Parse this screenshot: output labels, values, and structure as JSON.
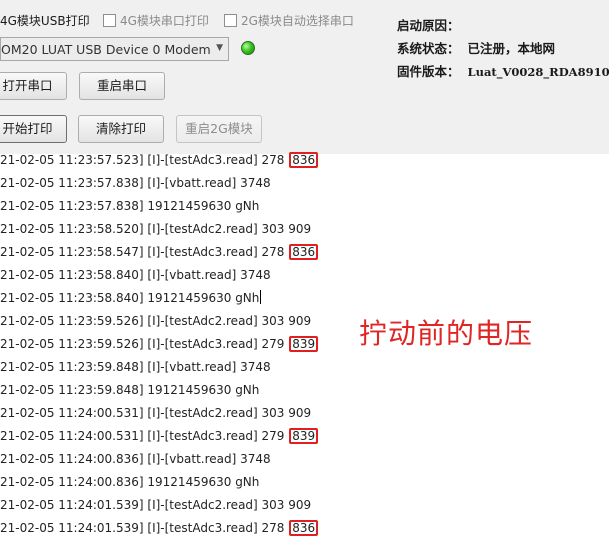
{
  "options": [
    {
      "label": "4G模块USB打印",
      "checkbox": false,
      "enabled": true
    },
    {
      "label": "4G模块串口打印",
      "checkbox": true,
      "checked": false,
      "enabled": false
    },
    {
      "label": "2G模块自动选择串口",
      "checkbox": true,
      "checked": false,
      "enabled": false
    }
  ],
  "port_select": {
    "value": "OM20 LUAT USB Device 0 Modem (C"
  },
  "status_led": {
    "color": "#39c621"
  },
  "buttons": {
    "open_port": "打开串口",
    "restart_port": "重启串口",
    "start_print": "开始打印",
    "clear_print": "清除打印",
    "restart_2g": "重启2G模块"
  },
  "info": {
    "boot_reason": {
      "label": "启动原因：",
      "value": ""
    },
    "system_status": {
      "label": "系统状态：",
      "value": "已注册，本地网"
    },
    "firmware": {
      "label": "固件版本：",
      "value": "Luat_V0028_RDA8910"
    }
  },
  "log": [
    {
      "text": "21-02-05 11:23:57.523] [I]-[testAdc3.read] 278 ",
      "highlight": "836"
    },
    {
      "text": "21-02-05 11:23:57.838] [I]-[vbatt.read] 3748"
    },
    {
      "text": "21-02-05 11:23:57.838] 19121459630 gNh"
    },
    {
      "text": "21-02-05 11:23:58.520] [I]-[testAdc2.read] 303 909"
    },
    {
      "text": "21-02-05 11:23:58.547] [I]-[testAdc3.read] 278 ",
      "highlight": "836"
    },
    {
      "text": "21-02-05 11:23:58.840] [I]-[vbatt.read] 3748"
    },
    {
      "text": "21-02-05 11:23:58.840] 19121459630 gNh",
      "cursor": true
    },
    {
      "text": "21-02-05 11:23:59.526] [I]-[testAdc2.read] 303 909"
    },
    {
      "text": "21-02-05 11:23:59.526] [I]-[testAdc3.read] 279 ",
      "highlight": "839"
    },
    {
      "text": "21-02-05 11:23:59.848] [I]-[vbatt.read] 3748"
    },
    {
      "text": "21-02-05 11:23:59.848] 19121459630 gNh"
    },
    {
      "text": "21-02-05 11:24:00.531] [I]-[testAdc2.read] 303 909"
    },
    {
      "text": "21-02-05 11:24:00.531] [I]-[testAdc3.read] 279 ",
      "highlight": "839"
    },
    {
      "text": "21-02-05 11:24:00.836] [I]-[vbatt.read] 3748"
    },
    {
      "text": "21-02-05 11:24:00.836] 19121459630 gNh"
    },
    {
      "text": "21-02-05 11:24:01.539] [I]-[testAdc2.read] 303 909"
    },
    {
      "text": "21-02-05 11:24:01.539] [I]-[testAdc3.read] 278 ",
      "highlight": "836"
    }
  ],
  "annotation": {
    "text": "拧动前的电压",
    "color": "#e02525"
  }
}
